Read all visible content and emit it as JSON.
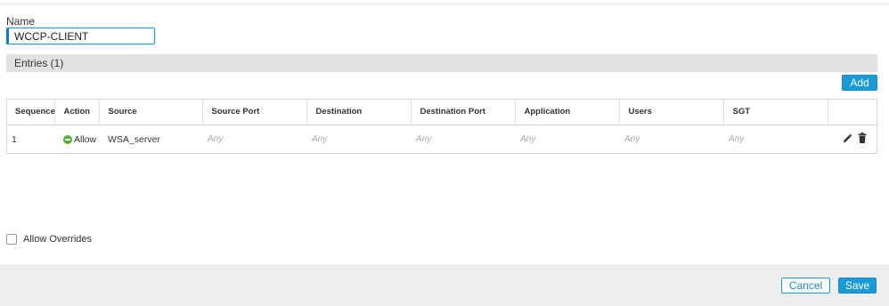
{
  "form": {
    "name_label": "Name",
    "name_value": "WCCP-CLIENT"
  },
  "entries": {
    "header": "Entries (1)",
    "add_label": "Add",
    "columns": [
      "Sequence",
      "Action",
      "Source",
      "Source Port",
      "Destination",
      "Destination Port",
      "Application",
      "Users",
      "SGT"
    ],
    "rows": [
      {
        "sequence": "1",
        "action": "Allow",
        "source": "WSA_server",
        "source_port": "Any",
        "destination": "Any",
        "destination_port": "Any",
        "application": "Any",
        "users": "Any",
        "sgt": "Any"
      }
    ]
  },
  "options": {
    "allow_overrides_label": "Allow Overrides",
    "allow_overrides_checked": false
  },
  "footer": {
    "cancel_label": "Cancel",
    "save_label": "Save"
  },
  "colors": {
    "accent": "#1a9ad6",
    "allow_green": "#55b135",
    "placeholder_any": "#aaaaaa"
  },
  "icons": {
    "allow": "allow-circle-icon",
    "edit": "pencil-icon",
    "delete": "trash-icon"
  }
}
